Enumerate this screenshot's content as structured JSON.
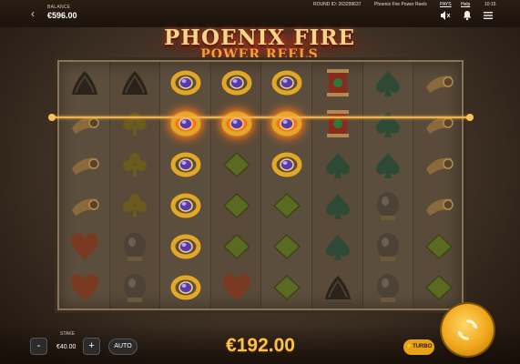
{
  "topbar": {
    "balance_label": "BALANCE",
    "balance_value": "€596.00",
    "round_id": "ROUND ID: 263299637",
    "game_name": "Phoenix Fire Power Reels",
    "paytable": "PAYS",
    "help": "Help",
    "clock": "10:15",
    "icons": [
      "back-arrow-icon",
      "sound-off-icon",
      "notification-bell-icon",
      "menu-icon"
    ]
  },
  "logo": {
    "title": "PHOENIX FIRE",
    "subtitle": "POWER REELS"
  },
  "reels": {
    "columns": 8,
    "grid": [
      [
        "bird",
        "bird",
        "ring",
        "ring",
        "ring",
        "scroll",
        "spade",
        "horn"
      ],
      [
        "horn",
        "club",
        "ring",
        "ring",
        "ring",
        "scroll",
        "spade",
        "horn"
      ],
      [
        "horn",
        "club",
        "ring",
        "diamond",
        "ring",
        "spade",
        "spade",
        "horn"
      ],
      [
        "horn",
        "club",
        "ring",
        "diamond",
        "diamond",
        "spade",
        "egg",
        "horn"
      ],
      [
        "heart",
        "egg",
        "ring",
        "diamond",
        "diamond",
        "spade",
        "egg",
        "diamond"
      ],
      [
        "heart",
        "egg",
        "ring",
        "heart",
        "diamond",
        "bird",
        "egg",
        "diamond"
      ]
    ],
    "winning_symbol": "ring",
    "colors": {
      "ring": "#e3a726",
      "ring_gem": "#5a3aa8",
      "win_glow": "#ff7a1a",
      "payline": "#f2b24a"
    }
  },
  "bottom": {
    "stake_label": "STAKE",
    "stake_value": "€40.00",
    "minus": "-",
    "plus": "+",
    "auto": "AUTO",
    "win_amount": "€192.00",
    "turbo": "TURBO",
    "spin_icon": "spin-arrows-icon"
  }
}
